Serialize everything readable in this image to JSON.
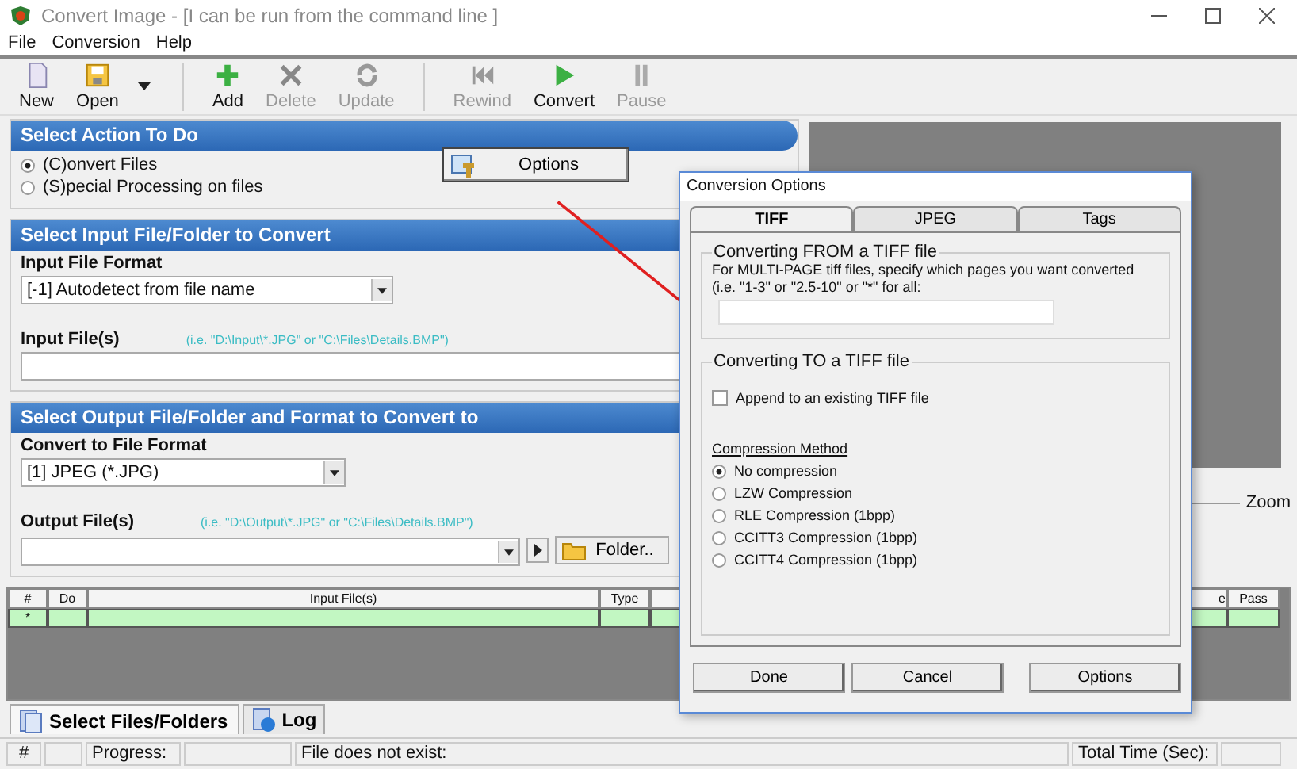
{
  "window": {
    "title": "Convert Image - [I can be run from the command line ]"
  },
  "menu": [
    "File",
    "Conversion",
    "Help"
  ],
  "toolbar": [
    [
      {
        "label": "New",
        "kind": "new",
        "disabled": false
      },
      {
        "label": "Open",
        "kind": "open",
        "disabled": false
      }
    ],
    [
      {
        "label": "Add",
        "kind": "add",
        "disabled": false
      },
      {
        "label": "Delete",
        "kind": "delete",
        "disabled": true
      },
      {
        "label": "Update",
        "kind": "update",
        "disabled": true
      }
    ],
    [
      {
        "label": "Rewind",
        "kind": "rewind",
        "disabled": true
      },
      {
        "label": "Convert",
        "kind": "convert",
        "disabled": false
      },
      {
        "label": "Pause",
        "kind": "pause",
        "disabled": true
      }
    ]
  ],
  "action": {
    "title": "Select Action To Do",
    "options": [
      {
        "label": "(C)onvert Files",
        "selected": true
      },
      {
        "label": "(S)pecial Processing on files",
        "selected": false
      }
    ],
    "options_button": "Options"
  },
  "input": {
    "title": "Select Input File/Folder to Convert",
    "format_label": "Input File Format",
    "format_value": "[-1] Autodetect from file name",
    "files_label": "Input File(s)",
    "files_hint": "(i.e. \"D:\\Input\\*.JPG\" or \"C:\\Files\\Details.BMP\")"
  },
  "output": {
    "title": "Select Output File/Folder and Format to Convert to",
    "format_label": "Convert to File Format",
    "format_value": "[1] JPEG (*.JPG)",
    "files_label": "Output File(s)",
    "files_hint": "(i.e. \"D:\\Output\\*.JPG\" or \"C:\\Files\\Details.BMP\")",
    "folder_button": "Folder.."
  },
  "preview": {
    "zoom_label": "Zoom"
  },
  "table": {
    "columns": [
      "#",
      "Do",
      "Input File(s)",
      "Type",
      "e",
      "Pass"
    ],
    "new_row_marker": "*"
  },
  "tabs": [
    {
      "label": "Select Files/Folders",
      "selected": true
    },
    {
      "label": "Log",
      "selected": false
    }
  ],
  "status_bar": {
    "count_label": "#",
    "progress_label": "Progress:",
    "message": "File does not exist:",
    "time_label": "Total Time (Sec):"
  },
  "dialog": {
    "title": "Conversion Options",
    "tabs": [
      {
        "label": "TIFF",
        "selected": true
      },
      {
        "label": "JPEG",
        "selected": false
      },
      {
        "label": "Tags",
        "selected": false
      }
    ],
    "from_group": {
      "title": "Converting FROM a TIFF file",
      "text": "For MULTI-PAGE tiff files, specify which pages you want converted (i.e. \"1-3\" or \"2.5-10\" or \"*\" for all:"
    },
    "to_group": {
      "title": "Converting TO a TIFF file",
      "append": {
        "label": "Append to an existing TIFF file",
        "checked": false
      },
      "compression_label": "Compression Method",
      "compression": [
        {
          "label": "No compression",
          "selected": true
        },
        {
          "label": "LZW Compression",
          "selected": false
        },
        {
          "label": "RLE Compression (1bpp)",
          "selected": false
        },
        {
          "label": "CCITT3 Compression (1bpp)",
          "selected": false
        },
        {
          "label": "CCITT4 Compression (1bpp)",
          "selected": false
        }
      ]
    },
    "buttons": [
      "Done",
      "Cancel",
      "Options"
    ]
  }
}
